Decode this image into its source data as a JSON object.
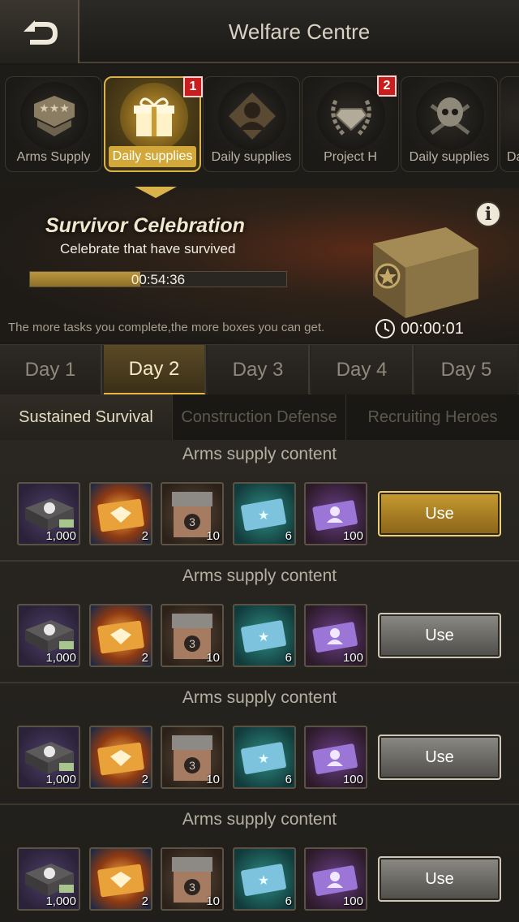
{
  "header": {
    "title": "Welfare Centre",
    "back_icon": "back-arrow-icon"
  },
  "categories": [
    {
      "label": "Arms Supply",
      "icon": "rank-chevron-icon",
      "badge": ""
    },
    {
      "label": "Daily supplies",
      "icon": "gift-box-icon",
      "badge": "1",
      "active": true
    },
    {
      "label": "Daily supplies",
      "icon": "soldier-portrait-icon",
      "badge": ""
    },
    {
      "label": "Project H",
      "icon": "diamond-laurel-icon",
      "badge": "2"
    },
    {
      "label": "Daily supplies",
      "icon": "skull-crossbones-icon",
      "badge": ""
    },
    {
      "label": "Da",
      "icon": "",
      "badge": ""
    }
  ],
  "banner": {
    "title": "Survivor Celebration",
    "subtitle": "Celebrate that have survived",
    "progress_time": "00:54:36",
    "progress_fraction": 0.43,
    "note": "The more tasks you complete,the more boxes you can get.",
    "timer": "00:00:01",
    "info_label": "i"
  },
  "days": [
    {
      "label": "Day 1"
    },
    {
      "label": "Day 2",
      "active": true
    },
    {
      "label": "Day 3"
    },
    {
      "label": "Day 4"
    },
    {
      "label": "Day 5"
    }
  ],
  "subtabs": [
    {
      "label": "Sustained Survival",
      "active": true
    },
    {
      "label": "Construction Defense"
    },
    {
      "label": "Recruiting Heroes"
    }
  ],
  "rows": [
    {
      "title": "Arms supply content",
      "button": "Use",
      "button_style": "gold",
      "items": [
        {
          "type": "cash-case-icon",
          "qty": "1,000"
        },
        {
          "type": "gold-ticket-icon",
          "qty": "2"
        },
        {
          "type": "supply-box-icon",
          "qty": "10"
        },
        {
          "type": "blue-card-icon",
          "qty": "6"
        },
        {
          "type": "hero-card-icon",
          "qty": "100"
        }
      ]
    },
    {
      "title": "Arms supply content",
      "button": "Use",
      "button_style": "grey",
      "items": [
        {
          "type": "cash-case-icon",
          "qty": "1,000"
        },
        {
          "type": "gold-ticket-icon",
          "qty": "2"
        },
        {
          "type": "supply-box-icon",
          "qty": "10"
        },
        {
          "type": "blue-card-icon",
          "qty": "6"
        },
        {
          "type": "hero-card-icon",
          "qty": "100"
        }
      ]
    },
    {
      "title": "Arms supply content",
      "button": "Use",
      "button_style": "grey",
      "items": [
        {
          "type": "cash-case-icon",
          "qty": "1,000"
        },
        {
          "type": "gold-ticket-icon",
          "qty": "2"
        },
        {
          "type": "supply-box-icon",
          "qty": "10"
        },
        {
          "type": "blue-card-icon",
          "qty": "6"
        },
        {
          "type": "hero-card-icon",
          "qty": "100"
        }
      ]
    },
    {
      "title": "Arms supply content",
      "button": "Use",
      "button_style": "grey",
      "items": [
        {
          "type": "cash-case-icon",
          "qty": "1,000"
        },
        {
          "type": "gold-ticket-icon",
          "qty": "2"
        },
        {
          "type": "supply-box-icon",
          "qty": "10"
        },
        {
          "type": "blue-card-icon",
          "qty": "6"
        },
        {
          "type": "hero-card-icon",
          "qty": "100"
        }
      ]
    }
  ],
  "colors": {
    "accent_gold": "#d9b24a",
    "badge_red": "#c81e1e",
    "background": "#1b1916"
  }
}
